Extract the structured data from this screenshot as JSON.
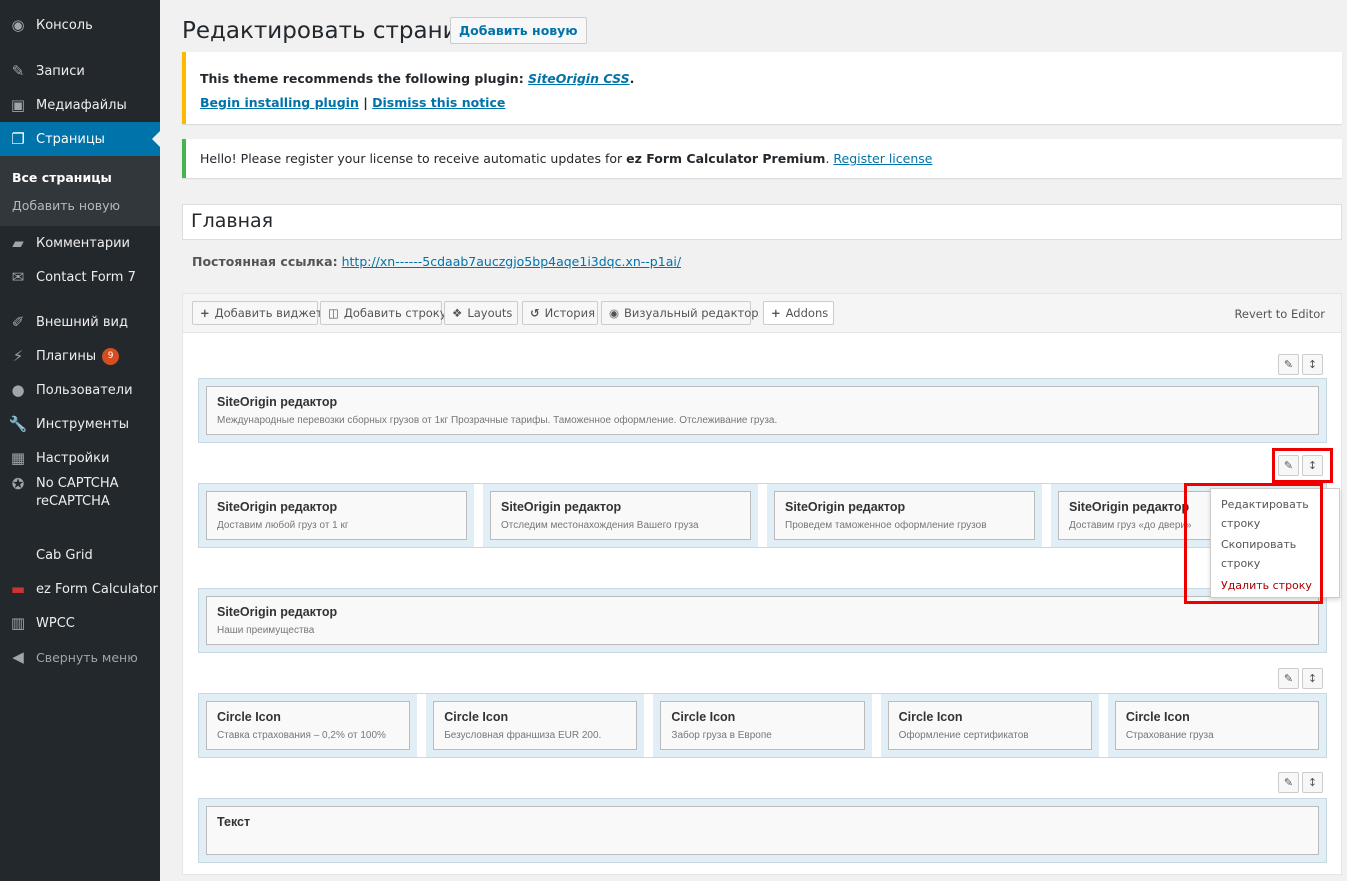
{
  "sidebar": {
    "items": [
      {
        "label": "Консоль",
        "icon": "dashboard-icon"
      },
      {
        "label": "Записи",
        "icon": "pin-icon"
      },
      {
        "label": "Медиафайлы",
        "icon": "media-icon"
      },
      {
        "label": "Страницы",
        "icon": "pages-icon",
        "active": true
      },
      {
        "label": "Комментарии",
        "icon": "comment-icon"
      },
      {
        "label": "Contact Form 7",
        "icon": "mail-icon"
      },
      {
        "label": "Внешний вид",
        "icon": "appearance-icon"
      },
      {
        "label": "Плагины",
        "icon": "plugin-icon",
        "badge": "9"
      },
      {
        "label": "Пользователи",
        "icon": "users-icon"
      },
      {
        "label": "Инструменты",
        "icon": "wrench-icon"
      },
      {
        "label": "Настройки",
        "icon": "settings-icon"
      },
      {
        "label": "No CAPTCHA reCAPTCHA",
        "icon": "award-icon"
      },
      {
        "label": "Cab Grid",
        "icon": ""
      },
      {
        "label": "ez Form Calculator",
        "icon": "flag-icon"
      },
      {
        "label": "WPCC",
        "icon": "calculator-icon"
      },
      {
        "label": "Свернуть меню",
        "icon": "collapse-icon"
      }
    ],
    "submenu": [
      "Все страницы",
      "Добавить новую"
    ]
  },
  "header": {
    "title": "Редактировать страницу",
    "add_new": "Добавить новую"
  },
  "notice1": {
    "text": "This theme recommends the following plugin: ",
    "plugin": "SiteOrigin CSS",
    "dot": ".",
    "install": "Begin installing plugin",
    "sep": " | ",
    "dismiss": "Dismiss this notice",
    "color": "#ffb900"
  },
  "notice2": {
    "text": "Hello! Please register your license to receive automatic updates for ",
    "product": "ez Form Calculator Premium",
    "dot": ". ",
    "link": "Register license",
    "color": "#46b450"
  },
  "page_title": "Главная",
  "permalink": {
    "label": "Постоянная ссылка:",
    "url": "http://xn------5cdaab7auczgjo5bp4aqe1i3dqc.xn--p1ai/"
  },
  "toolbar": {
    "buttons": [
      {
        "icon": "+",
        "label": "Добавить виджет"
      },
      {
        "icon": "◫",
        "label": "Добавить строку"
      },
      {
        "icon": "❖",
        "label": "Layouts"
      },
      {
        "icon": "↺",
        "label": "История"
      },
      {
        "icon": "◉",
        "label": "Визуальный редактор"
      },
      {
        "icon": "+",
        "label": "Addons"
      }
    ],
    "revert": "Revert to Editor"
  },
  "rows": [
    {
      "cells": [
        {
          "title": "SiteOrigin редактор",
          "desc": "Международные перевозки сборных грузов от 1кг Прозрачные тарифы. Таможенное оформление. Отслеживание груза."
        }
      ]
    },
    {
      "cells": [
        {
          "title": "SiteOrigin редактор",
          "desc": "Доставим любой груз от 1 кг"
        },
        {
          "title": "SiteOrigin редактор",
          "desc": "Отследим местонахождения Вашего груза"
        },
        {
          "title": "SiteOrigin редактор",
          "desc": "Проведем таможенное оформление грузов"
        },
        {
          "title": "SiteOrigin редактор",
          "desc": "Доставим груз «до двери»"
        }
      ]
    },
    {
      "cells": [
        {
          "title": "SiteOrigin редактор",
          "desc": "Наши преимущества"
        }
      ]
    },
    {
      "cells": [
        {
          "title": "Circle Icon",
          "desc": "Ставка страхования – 0,2% от 100%"
        },
        {
          "title": "Circle Icon",
          "desc": "Безусловная франшиза EUR 200."
        },
        {
          "title": "Circle Icon",
          "desc": "Забор груза в Европе"
        },
        {
          "title": "Circle Icon",
          "desc": "Оформление сертификатов"
        },
        {
          "title": "Circle Icon",
          "desc": "Страхование груза"
        }
      ]
    },
    {
      "cells": [
        {
          "title": "Текст",
          "desc": ""
        }
      ]
    }
  ],
  "row_menu": {
    "edit": "Редактировать строку",
    "copy": "Скопировать строку",
    "delete": "Удалить строку"
  },
  "highlight_color": "#e00000"
}
